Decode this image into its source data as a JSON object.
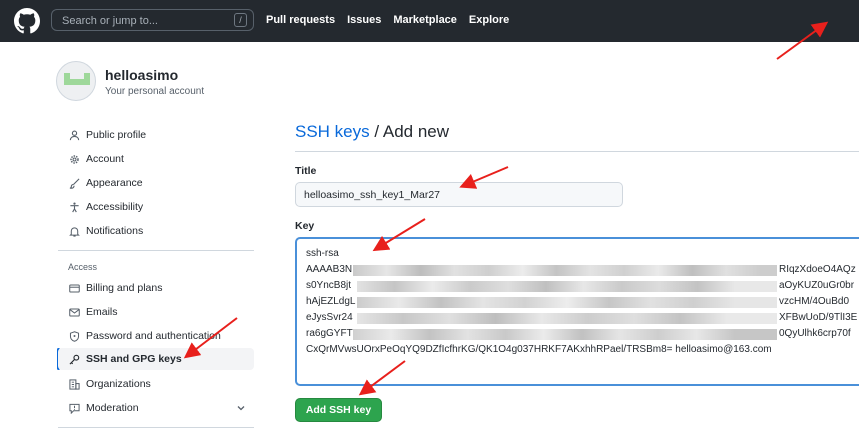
{
  "header": {
    "search_placeholder": "Search or jump to...",
    "search_shortcut": "/",
    "nav": [
      "Pull requests",
      "Issues",
      "Marketplace",
      "Explore"
    ]
  },
  "account": {
    "name": "helloasimo",
    "subtitle": "Your personal account"
  },
  "sidebar": {
    "items": [
      {
        "label": "Public profile",
        "icon": "person-icon"
      },
      {
        "label": "Account",
        "icon": "gear-icon"
      },
      {
        "label": "Appearance",
        "icon": "paintbrush-icon"
      },
      {
        "label": "Accessibility",
        "icon": "accessibility-icon"
      },
      {
        "label": "Notifications",
        "icon": "bell-icon"
      }
    ],
    "group_label": "Access",
    "access_items": [
      {
        "label": "Billing and plans",
        "icon": "credit-card-icon"
      },
      {
        "label": "Emails",
        "icon": "mail-icon"
      },
      {
        "label": "Password and authentication",
        "icon": "shield-lock-icon"
      },
      {
        "label": "SSH and GPG keys",
        "icon": "key-icon",
        "active": true
      },
      {
        "label": "Organizations",
        "icon": "organization-icon"
      },
      {
        "label": "Moderation",
        "icon": "report-icon"
      }
    ]
  },
  "main": {
    "breadcrumb_link": "SSH keys",
    "breadcrumb_sep": " / ",
    "breadcrumb_current": "Add new",
    "title_label": "Title",
    "title_value": "helloasimo_ssh_key1_Mar27",
    "key_label": "Key",
    "key_lines": [
      "ssh-rsa",
      "AAAAB3N",
      "s0YncB8jt",
      "hAjEZLdgL",
      "eJysSvr24",
      "ra6gGYFT",
      "CxQrMVwsUOrxPeOqYQ9DZfIcfhrKG/QK1O4g037HRKF7AKxhhRPael/TRSBm8= helloasimo@163.com"
    ],
    "key_line_ends": [
      "",
      "RIqzXdoeO4AQz",
      "aOyKUZ0uGr0br",
      "vzcHM/4OuBd0",
      "XFBwUoD/9TlI3E",
      "0QyUlhk6crp70f",
      ""
    ],
    "add_button": "Add SSH key"
  },
  "colors": {
    "header_bg": "#24292f",
    "link": "#0969da",
    "button_green": "#2da44e",
    "annotation_red": "#e8201c"
  }
}
